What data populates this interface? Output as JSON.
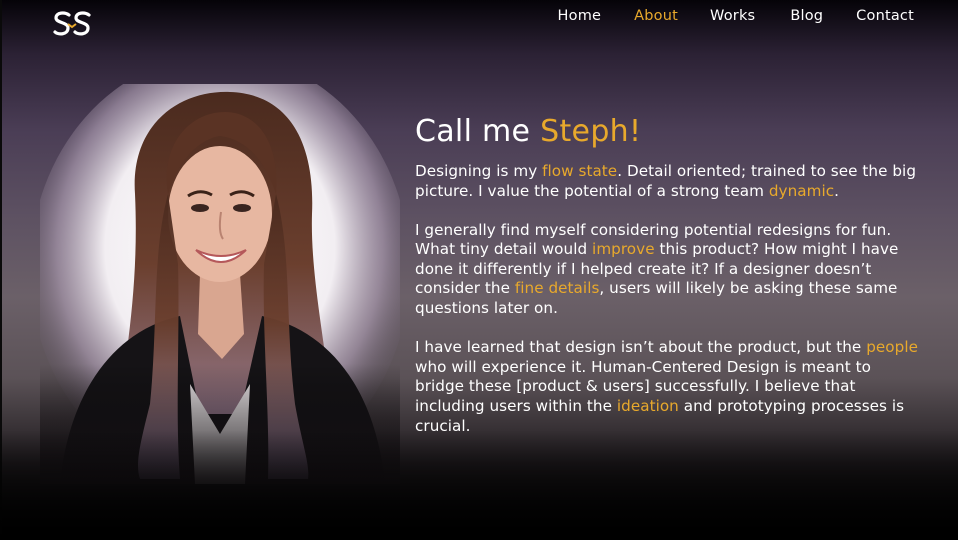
{
  "nav": {
    "logo_icon": "ss-monogram-logo-icon",
    "items": [
      {
        "label": "Home",
        "active": false
      },
      {
        "label": "About",
        "active": true
      },
      {
        "label": "Works",
        "active": false
      },
      {
        "label": "Blog",
        "active": false
      },
      {
        "label": "Contact",
        "active": false
      }
    ]
  },
  "about": {
    "headline_prefix": "Call me ",
    "headline_name": "Steph!",
    "p1": {
      "t1": "Designing is my ",
      "h1": "flow state",
      "t2": ". Detail oriented; trained to see the big picture. I value the potential of a strong team ",
      "h2": "dynamic",
      "t3": "."
    },
    "p2": {
      "t1": "I generally find myself considering potential redesigns for fun. What tiny detail would ",
      "h1": "improve",
      "t2": " this product? How might I have done it differently if I helped create it? If a designer doesn’t consider the ",
      "h2": "fine details",
      "t3": ", users will likely be asking these same questions later on."
    },
    "p3": {
      "t1": "I have learned that design isn’t about the product, but the ",
      "h1": "people",
      "t2": " who will experience it. Human-Centered Design is meant to bridge these [product & users] successfully. I believe that including users within the ",
      "h2": "ideation",
      "t3": " and prototyping processes is crucial."
    }
  },
  "colors": {
    "accent": "#e8a92c",
    "text": "#ffffff",
    "background_top": "#050308",
    "background_mid": "#5d5162",
    "background_bottom": "#000000"
  }
}
